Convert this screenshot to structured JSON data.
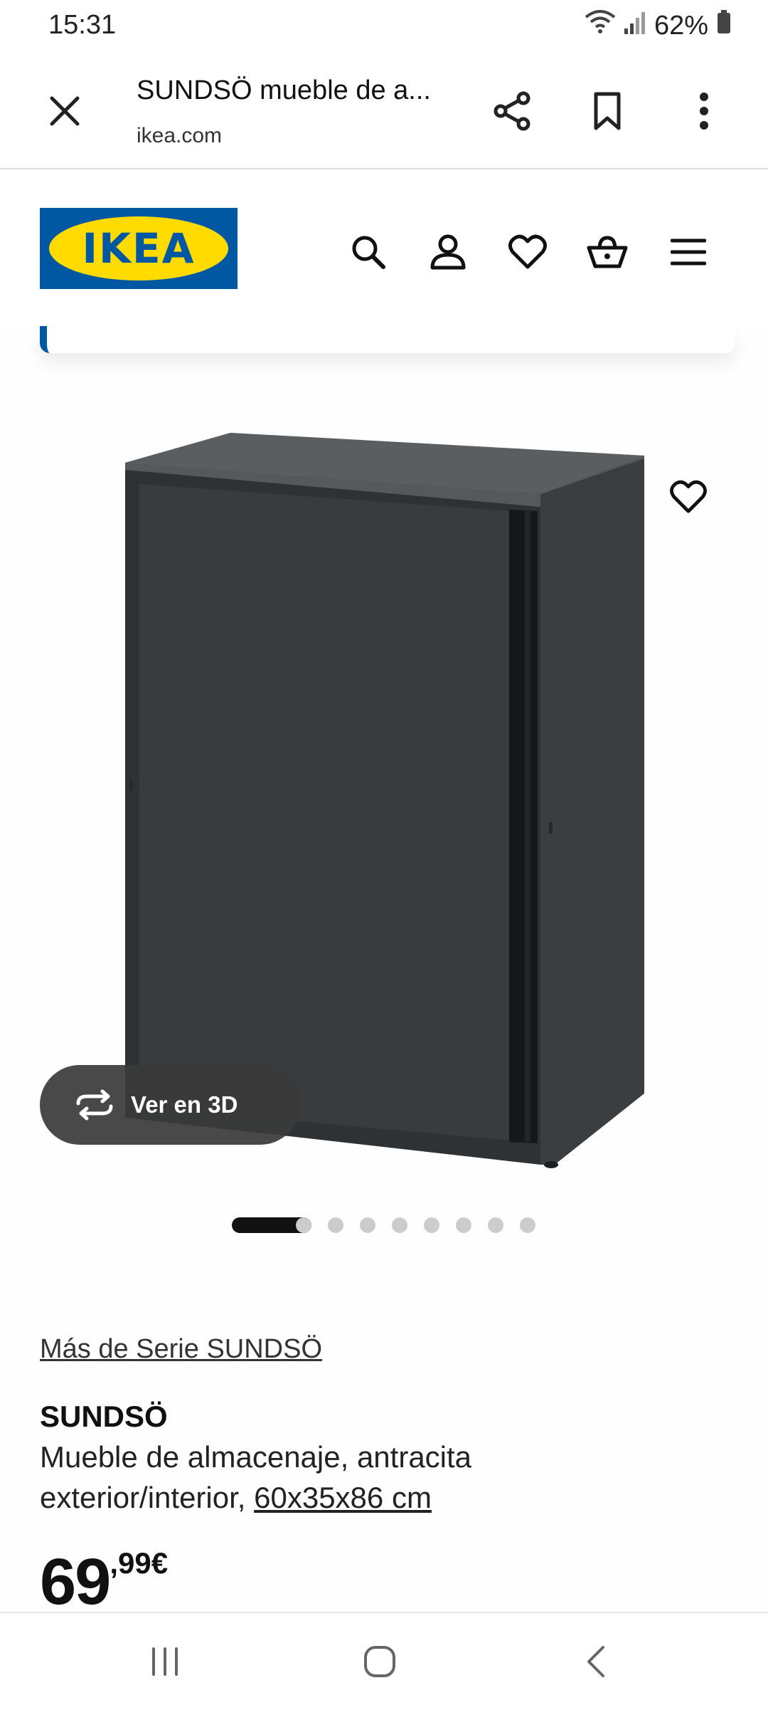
{
  "status_bar": {
    "time": "15:31",
    "battery": "62%"
  },
  "browser": {
    "title": "SUNDSÖ mueble de a...",
    "url": "ikea.com"
  },
  "brand": {
    "logo_text": "IKEA",
    "blue": "#0058a3",
    "yellow": "#ffdb00"
  },
  "header_icons": [
    "search-icon",
    "account-icon",
    "heart-icon",
    "cart-icon",
    "menu-icon"
  ],
  "gallery": {
    "view_3d_label": "Ver en 3D",
    "image_count": 9,
    "active_index": 0
  },
  "product": {
    "series_link": "Más de Serie SUNDSÖ",
    "name": "SUNDSÖ",
    "description": "Mueble de almacenaje, antracita exterior/interior,",
    "dimensions": "60x35x86 cm",
    "price_integer": "69",
    "price_decimal": ",99€"
  },
  "nav_bar": [
    "recent-apps-icon",
    "home-icon",
    "back-icon"
  ]
}
